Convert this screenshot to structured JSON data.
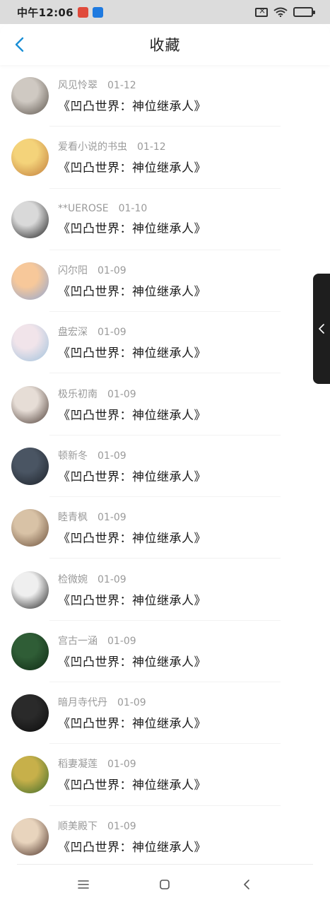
{
  "status_bar": {
    "time": "中午12:06"
  },
  "header": {
    "title": "收藏"
  },
  "items": [
    {
      "user": "风见怜翠",
      "date": "01-12",
      "book": "《凹凸世界：神位继承人》",
      "avatar_colors": [
        "#cfc9c2",
        "#5b534b"
      ]
    },
    {
      "user": "爱看小说的书虫",
      "date": "01-12",
      "book": "《凹凸世界：神位继承人》",
      "avatar_colors": [
        "#f4d37a",
        "#c07b3a"
      ]
    },
    {
      "user": "**UEROSE",
      "date": "01-10",
      "book": "《凹凸世界：神位继承人》",
      "avatar_colors": [
        "#d9d9d9",
        "#1c1c1c"
      ]
    },
    {
      "user": "闪尔阳",
      "date": "01-09",
      "book": "《凹凸世界：神位继承人》",
      "avatar_colors": [
        "#f7c89a",
        "#8fa6d4"
      ]
    },
    {
      "user": "盘宏深",
      "date": "01-09",
      "book": "《凹凸世界：神位继承人》",
      "avatar_colors": [
        "#f1e4ea",
        "#9ec1dc"
      ]
    },
    {
      "user": "极乐初南",
      "date": "01-09",
      "book": "《凹凸世界：神位继承人》",
      "avatar_colors": [
        "#e6ddd6",
        "#4a3a33"
      ]
    },
    {
      "user": "顿新冬",
      "date": "01-09",
      "book": "《凹凸世界：神位继承人》",
      "avatar_colors": [
        "#4a5563",
        "#1d222a"
      ]
    },
    {
      "user": "睦青枫",
      "date": "01-09",
      "book": "《凹凸世界：神位继承人》",
      "avatar_colors": [
        "#d8c2a6",
        "#6b4f3a"
      ]
    },
    {
      "user": "检微婉",
      "date": "01-09",
      "book": "《凹凸世界：神位继承人》",
      "avatar_colors": [
        "#efefef",
        "#222222"
      ]
    },
    {
      "user": "宫古一涵",
      "date": "01-09",
      "book": "《凹凸世界：神位继承人》",
      "avatar_colors": [
        "#2f5d36",
        "#0f2a14"
      ]
    },
    {
      "user": "暗月寺代丹",
      "date": "01-09",
      "book": "《凹凸世界：神位继承人》",
      "avatar_colors": [
        "#2a2a2a",
        "#0b0b0b"
      ]
    },
    {
      "user": "稻妻凝莲",
      "date": "01-09",
      "book": "《凹凸世界：神位继承人》",
      "avatar_colors": [
        "#c7b04a",
        "#3d6b2a"
      ]
    },
    {
      "user": "顺美殿下",
      "date": "01-09",
      "book": "《凹凸世界：神位继承人》",
      "avatar_colors": [
        "#e8d4bd",
        "#4a2f25"
      ]
    }
  ],
  "colors": {
    "accent": "#1a8fd6",
    "meta_text": "#9a9a9a",
    "book_text": "#1a1a1a"
  },
  "icons": {
    "back": "chevron-left-icon",
    "side_tab": "chevron-left-icon",
    "nav": [
      "menu-icon",
      "home-square-icon",
      "back-icon"
    ]
  }
}
